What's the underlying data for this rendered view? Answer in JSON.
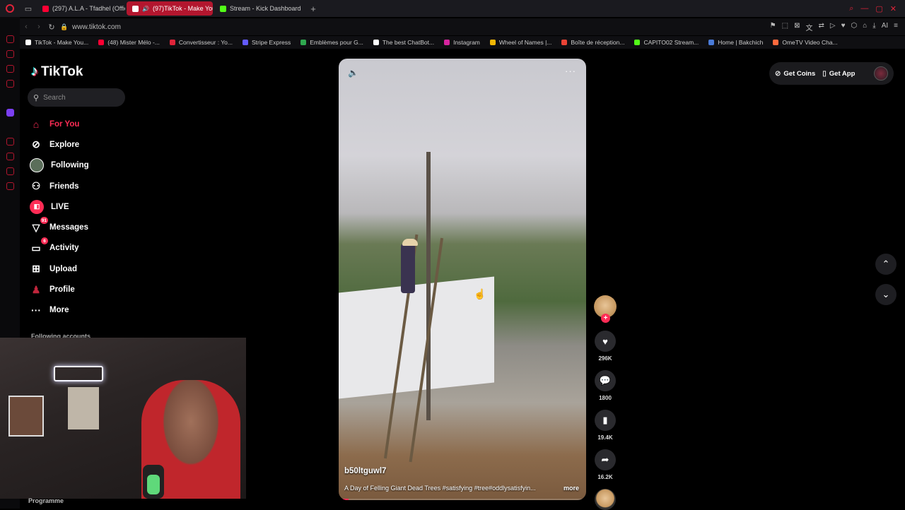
{
  "browser": {
    "tabs": [
      {
        "label": "(297) A.L.A - Tfadhel (Offic",
        "color": "#ff0033",
        "active": false
      },
      {
        "label": "(97)TikTok - Make You",
        "color": "#ffffff",
        "active": true
      },
      {
        "label": "Stream - Kick Dashboard",
        "color": "#53fc18",
        "active": false
      }
    ],
    "url": "www.tiktok.com",
    "bookmarks": [
      {
        "label": "TikTok - Make You...",
        "color": "#ffffff"
      },
      {
        "label": "(48) Mister Mélo -...",
        "color": "#ff0033"
      },
      {
        "label": "Convertisseur : Yo...",
        "color": "#e0243a"
      },
      {
        "label": "Stripe Express",
        "color": "#635bff"
      },
      {
        "label": "Emblèmes pour G...",
        "color": "#2fa84f"
      },
      {
        "label": "The best ChatBot...",
        "color": "#ffffff"
      },
      {
        "label": "Instagram",
        "color": "#d6249f"
      },
      {
        "label": "Wheel of Names |...",
        "color": "#f2b705"
      },
      {
        "label": "Boîte de réception...",
        "color": "#ea4335"
      },
      {
        "label": "CAPITO02 Stream...",
        "color": "#53fc18"
      },
      {
        "label": "Home | Bakchich",
        "color": "#4a7bd8"
      },
      {
        "label": "OmeTV Video Cha...",
        "color": "#ff6a3d"
      }
    ]
  },
  "tiktok": {
    "logo": "TikTok",
    "search_placeholder": "Search",
    "nav": [
      {
        "label": "For You",
        "icon": "home-icon",
        "active": true
      },
      {
        "label": "Explore",
        "icon": "compass-icon"
      },
      {
        "label": "Following",
        "icon": "following-avatar-icon"
      },
      {
        "label": "Friends",
        "icon": "friends-icon"
      },
      {
        "label": "LIVE",
        "icon": "live-icon"
      },
      {
        "label": "Messages",
        "icon": "messages-icon",
        "badge": "91"
      },
      {
        "label": "Activity",
        "icon": "activity-icon",
        "badge": "6"
      },
      {
        "label": "Upload",
        "icon": "upload-icon"
      },
      {
        "label": "Profile",
        "icon": "profile-icon"
      },
      {
        "label": "More",
        "icon": "more-icon"
      }
    ],
    "following_accounts_label": "Following accounts",
    "programme_label": "Programme",
    "top_actions": {
      "get_coins": "Get Coins",
      "get_app": "Get App"
    },
    "video": {
      "author": "b50ltguwl7",
      "description": "A Day of Felling Giant Dead Trees #satisfying #tree#oddlysatisfyin...",
      "more_label": "more",
      "progress": 0.04
    },
    "actions": {
      "likes": "296K",
      "comments": "1800",
      "saves": "19.4K",
      "shares": "16.2K"
    },
    "accent": "#fe2c55"
  }
}
